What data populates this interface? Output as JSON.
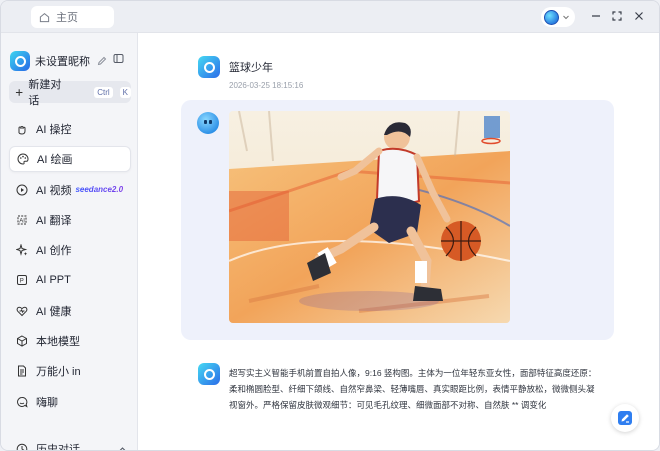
{
  "titlebar": {
    "home_tab": "主页"
  },
  "sidebar": {
    "username": "未设置昵称",
    "new_chat": {
      "label": "新建对话",
      "shortcut_keys": [
        "Ctrl",
        "K"
      ]
    },
    "items": [
      {
        "label": "AI 操控",
        "icon": "cursor-icon"
      },
      {
        "label": "AI 绘画",
        "icon": "palette-icon",
        "active": true
      },
      {
        "label": "AI 视频",
        "icon": "video-icon",
        "badge": "seedance2.0"
      },
      {
        "label": "AI 翻译",
        "icon": "translate-icon"
      },
      {
        "label": "AI 创作",
        "icon": "sparkle-icon"
      },
      {
        "label": "AI PPT",
        "icon": "ppt-icon"
      },
      {
        "label": "AI 健康",
        "icon": "heart-icon"
      },
      {
        "label": "本地模型",
        "icon": "cube-icon"
      },
      {
        "label": "万能小 in",
        "icon": "document-icon"
      },
      {
        "label": "嗨聊",
        "icon": "chat-icon"
      }
    ],
    "history_label": "历史对话"
  },
  "conversation": {
    "user_message": "篮球少年",
    "timestamp": "2026-03-25 18:15:16",
    "image_description_text": "超写实主义智能手机前置自拍人像，9:16 竖构图。主体为一位年轻东亚女性，面部特征高度还原：柔和椭圆脸型、纤细下颌线、自然窄鼻梁、轻薄嘴唇、真实眼距比例，表情平静放松，微微侧头凝视窗外。严格保留皮肤微观细节：可见毛孔纹理、细微面部不对称、自然肤 ** 调变化"
  },
  "colors": {
    "accent": "#2b6ce8",
    "answer_bg": "#eef1fb",
    "sidebar_bg": "#f4f5f8"
  }
}
